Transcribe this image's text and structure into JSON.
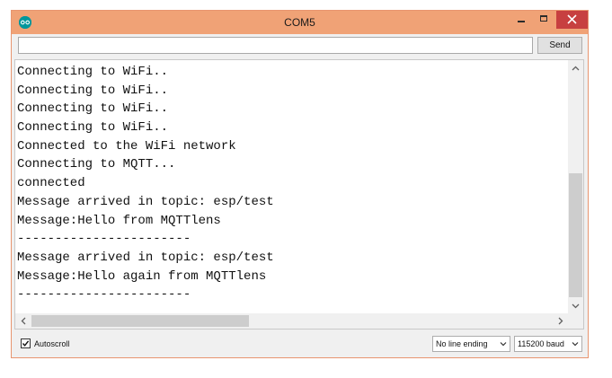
{
  "window": {
    "title": "COM5",
    "controls": {
      "minimize": "minimize",
      "maximize": "maximize",
      "close": "close"
    },
    "accent_color": "#f0a276",
    "close_color": "#c74040"
  },
  "send_row": {
    "input_value": "",
    "input_placeholder": "",
    "send_label": "Send"
  },
  "console": {
    "lines": [
      "Connecting to WiFi..",
      "Connecting to WiFi..",
      "Connecting to WiFi..",
      "Connecting to WiFi..",
      "Connected to the WiFi network",
      "Connecting to MQTT...",
      "connected",
      "Message arrived in topic: esp/test",
      "Message:Hello from MQTTlens",
      "-----------------------",
      "Message arrived in topic: esp/test",
      "Message:Hello again from MQTTlens",
      "-----------------------"
    ]
  },
  "bottom_bar": {
    "autoscroll_label": "Autoscroll",
    "autoscroll_checked": true,
    "line_ending_selected": "No line ending",
    "baud_selected": "115200 baud"
  },
  "icons": {
    "app": "arduino-icon",
    "checkbox": "checkmark-icon",
    "dropdown": "chevron-down-icon",
    "scroll_up": "chevron-up-icon",
    "scroll_down": "chevron-down-icon",
    "scroll_left": "chevron-left-icon",
    "scroll_right": "chevron-right-icon"
  }
}
